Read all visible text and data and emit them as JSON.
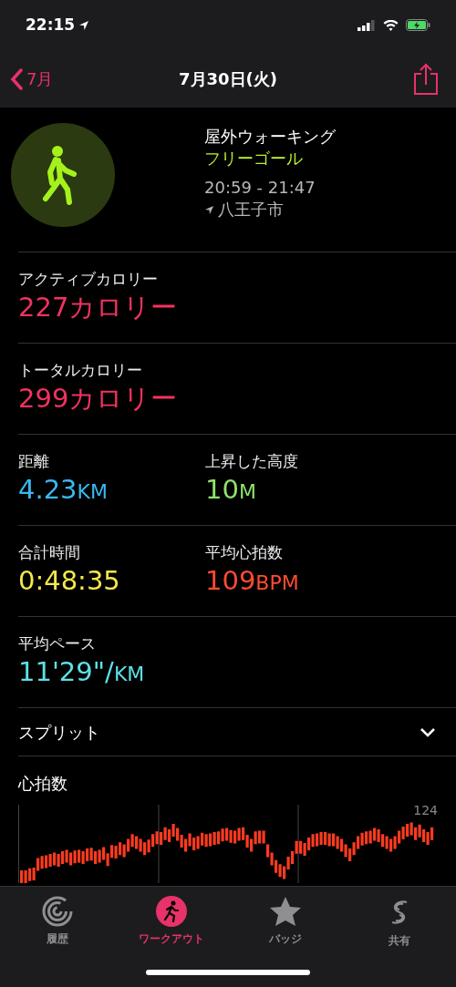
{
  "status_bar": {
    "time": "22:15"
  },
  "nav": {
    "back": "7月",
    "title": "7月30日(火)"
  },
  "workout": {
    "name": "屋外ウォーキング",
    "goal": "フリーゴール",
    "time_range": "20:59 - 21:47",
    "location": "八王子市"
  },
  "metric_rows": [
    {
      "cells": [
        {
          "label": "アクティブカロリー",
          "value": "227",
          "unit": "カロリー",
          "color": "#f2325f"
        }
      ]
    },
    {
      "cells": [
        {
          "label": "トータルカロリー",
          "value": "299",
          "unit": "カロリー",
          "color": "#f2325f"
        }
      ]
    },
    {
      "cells": [
        {
          "label": "距離",
          "value": "4.23",
          "unit": "KM",
          "color": "#3ab8f0"
        },
        {
          "label": "上昇した高度",
          "value": "10",
          "unit": "M",
          "color": "#8fe26a"
        }
      ]
    },
    {
      "cells": [
        {
          "label": "合計時間",
          "value": "0:48:35",
          "color": "#f4e84a"
        },
        {
          "label": "平均心拍数",
          "value": "109",
          "unit": "BPM",
          "color": "#ff4b30"
        }
      ]
    },
    {
      "cells": [
        {
          "label": "平均ペース",
          "value": "11'29\"/",
          "unit": "KM",
          "color": "#5ee0e6"
        }
      ]
    }
  ],
  "splits": {
    "label": "スプリット",
    "expanded": false
  },
  "heart_rate": {
    "title": "心拍数",
    "max_label": "124"
  },
  "tab_bar": [
    {
      "label": "履歴",
      "selected": false,
      "kind": "history"
    },
    {
      "label": "ワークアウト",
      "selected": true,
      "kind": "workout"
    },
    {
      "label": "バッジ",
      "selected": false,
      "kind": "badge"
    },
    {
      "label": "共有",
      "selected": false,
      "kind": "share"
    }
  ]
}
